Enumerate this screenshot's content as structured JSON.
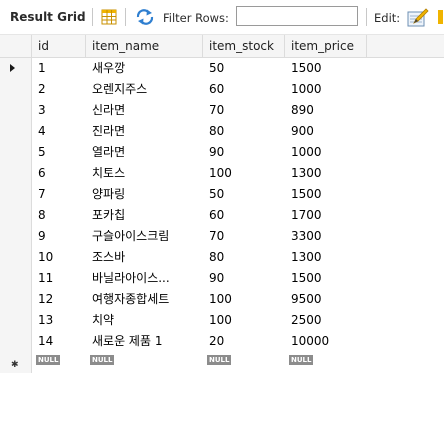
{
  "toolbar": {
    "result_grid_label": "Result Grid",
    "filter_rows_label": "Filter Rows:",
    "filter_value": "",
    "edit_label": "Edit:"
  },
  "columns": [
    "id",
    "item_name",
    "item_stock",
    "item_price"
  ],
  "rows": [
    {
      "id": "1",
      "item_name": "새우깡",
      "item_stock": "50",
      "item_price": "1500"
    },
    {
      "id": "2",
      "item_name": "오렌지주스",
      "item_stock": "60",
      "item_price": "1000"
    },
    {
      "id": "3",
      "item_name": "신라면",
      "item_stock": "70",
      "item_price": "890"
    },
    {
      "id": "4",
      "item_name": "진라면",
      "item_stock": "80",
      "item_price": "900"
    },
    {
      "id": "5",
      "item_name": "열라면",
      "item_stock": "90",
      "item_price": "1000"
    },
    {
      "id": "6",
      "item_name": "치토스",
      "item_stock": "100",
      "item_price": "1300"
    },
    {
      "id": "7",
      "item_name": "양파링",
      "item_stock": "50",
      "item_price": "1500"
    },
    {
      "id": "8",
      "item_name": "포카칩",
      "item_stock": "60",
      "item_price": "1700"
    },
    {
      "id": "9",
      "item_name": "구슬아이스크림",
      "item_stock": "70",
      "item_price": "3300"
    },
    {
      "id": "10",
      "item_name": "조스바",
      "item_stock": "80",
      "item_price": "1300"
    },
    {
      "id": "11",
      "item_name": "바닐라아이스...",
      "item_stock": "90",
      "item_price": "1500"
    },
    {
      "id": "12",
      "item_name": "여행자종합세트",
      "item_stock": "100",
      "item_price": "9500"
    },
    {
      "id": "13",
      "item_name": "치약",
      "item_stock": "100",
      "item_price": "2500"
    },
    {
      "id": "14",
      "item_name": "새로운 제품 1",
      "item_stock": "20",
      "item_price": "10000"
    }
  ],
  "new_row": {
    "id": "NULL",
    "item_name": "NULL",
    "item_stock": "NULL",
    "item_price": "NULL"
  },
  "current_row_indicator": "▶",
  "new_row_indicator": "✱",
  "icons": {
    "grid": "grid-view-icon",
    "refresh": "refresh-icon",
    "edit": "edit-pencil-icon"
  },
  "colors": {
    "header_bg": "#f5f5f5",
    "null_badge": "#8c8c8c",
    "icon_yellow": "#f0b400",
    "icon_blue": "#2f7fd0"
  }
}
